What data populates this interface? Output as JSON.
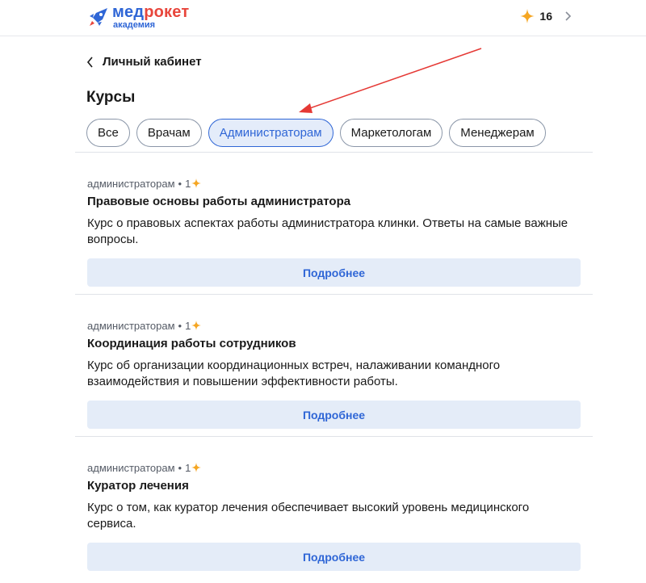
{
  "header": {
    "logo_name_main": "мед",
    "logo_name_accent": "рокет",
    "logo_sub": "академия",
    "points": "16",
    "star_color": "#f5a623",
    "brand_color": "#2f66d6"
  },
  "breadcrumb": {
    "label": "Личный кабинет"
  },
  "page": {
    "title": "Курсы"
  },
  "tabs": [
    {
      "label": "Все",
      "active": false
    },
    {
      "label": "Врачам",
      "active": false
    },
    {
      "label": "Администраторам",
      "active": true
    },
    {
      "label": "Маркетологам",
      "active": false
    },
    {
      "label": "Менеджерам",
      "active": false
    }
  ],
  "courses": [
    {
      "audience": "администраторам",
      "separator": "•",
      "points": "1",
      "title": "Правовые основы работы администратора",
      "description": "Курс о правовых аспектах работы администратора клинки. Ответы на самые важные вопросы.",
      "button": "Подробнее"
    },
    {
      "audience": "администраторам",
      "separator": "•",
      "points": "1",
      "title": "Координация работы сотрудников",
      "description": "Курс об организации координационных встреч, налаживании командного взаимодействия и повышении эффективности работы.",
      "button": "Подробнее"
    },
    {
      "audience": "администраторам",
      "separator": "•",
      "points": "1",
      "title": "Куратор лечения",
      "description": "Курс о том, как куратор лечения обеспечивает высокий уровень медицинского сервиса.",
      "button": "Подробнее"
    }
  ]
}
